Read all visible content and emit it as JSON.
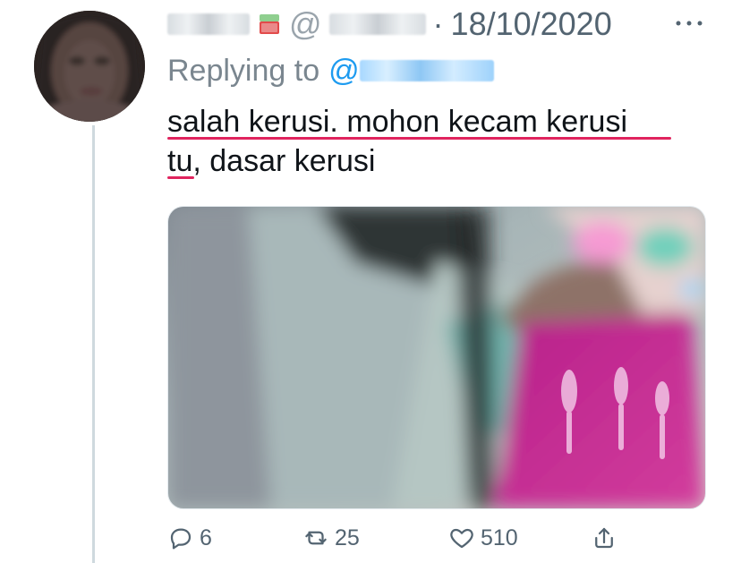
{
  "author": {
    "name_text": "",
    "handle_text": "@",
    "avatar_icon": "blurred-avatar-icon",
    "flag_icon": "flag-emoji-icon"
  },
  "tweet": {
    "separator": "·",
    "date": "18/10/2020",
    "more_icon": "more-horizontal-icon",
    "reply_prefix": "Replying to",
    "reply_at": "@",
    "text_lines": [
      "salah kerusi. mohon kecam kerusi",
      "tu, dasar kerusi"
    ],
    "media_description_icon": "blurred-media-icon"
  },
  "actions": {
    "reply_count": "6",
    "retweet_count": "25",
    "like_count": "510",
    "reply_icon": "comment-icon",
    "retweet_icon": "retweet-icon",
    "like_icon": "heart-icon",
    "share_icon": "share-icon"
  },
  "colors": {
    "accent": "#1d9bf0",
    "text": "#0f1419",
    "secondary": "#536471",
    "spellcheck": "#e0245e",
    "thread_line": "#cfd9de"
  }
}
